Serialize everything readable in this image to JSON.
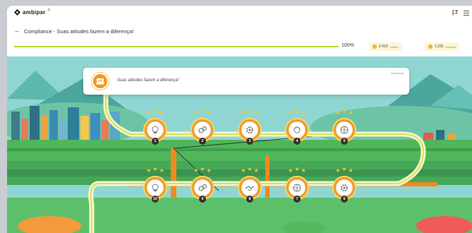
{
  "brand": {
    "name": "ambipar",
    "sup": "®"
  },
  "header": {
    "title": "Compliance - Suas atitudes fazem a diferença!"
  },
  "progress": {
    "percent_text": "100%",
    "percent": 100
  },
  "stats": [
    {
      "value": "2.410",
      "label": "pontos"
    },
    {
      "value": "1.231",
      "label": "moedas"
    }
  ],
  "intro": {
    "text": "Suas atitudes fazem a diferença!",
    "status": "Concluído"
  },
  "nodes_row1": [
    {
      "num": "1",
      "icon": "lightbulb-icon"
    },
    {
      "num": "2",
      "icon": "gears-icon"
    },
    {
      "num": "3",
      "icon": "gear-icon"
    },
    {
      "num": "4",
      "icon": "cycle-icon"
    },
    {
      "num": "5",
      "icon": "globe-icon"
    }
  ],
  "nodes_row2": [
    {
      "num": "10",
      "icon": "lightbulb-icon"
    },
    {
      "num": "9",
      "icon": "gears-icon"
    },
    {
      "num": "8",
      "icon": "handshake-icon"
    },
    {
      "num": "7",
      "icon": "globe-icon"
    },
    {
      "num": "6",
      "icon": "gear-icon"
    }
  ],
  "colors": {
    "accent": "#b8d430",
    "node": "#f39a1e",
    "sky": "#8fd6d3",
    "grass": "#4fb65a"
  }
}
